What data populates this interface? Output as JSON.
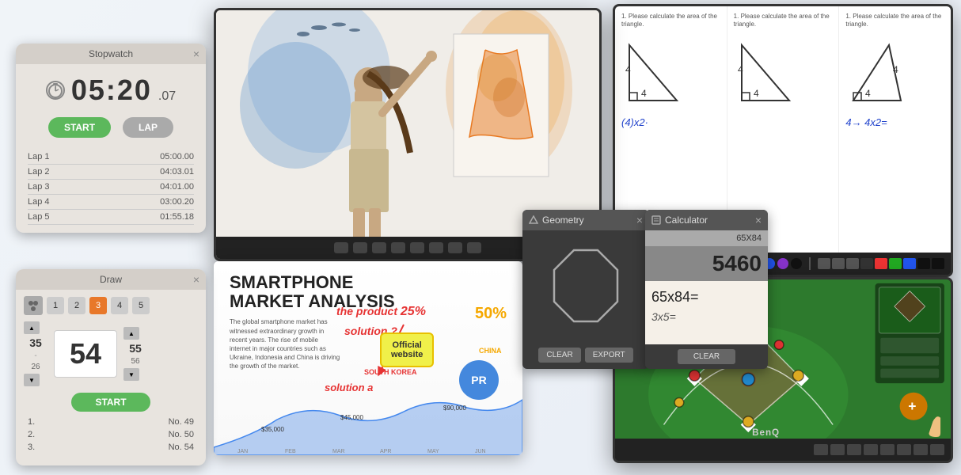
{
  "stopwatch": {
    "title": "Stopwatch",
    "time_main": "05:20",
    "time_ms": ".07",
    "btn_start": "START",
    "btn_lap": "LAP",
    "laps": [
      {
        "label": "Lap 1",
        "time": "05:00.00"
      },
      {
        "label": "Lap 2",
        "time": "04:03.01"
      },
      {
        "label": "Lap 3",
        "time": "04:01.00"
      },
      {
        "label": "Lap 4",
        "time": "03:00.20"
      },
      {
        "label": "Lap 5",
        "time": "01:55.18"
      }
    ]
  },
  "draw": {
    "title": "Draw",
    "numbers": [
      "1",
      "2",
      "3",
      "4",
      "5"
    ],
    "active_number": "3",
    "score": "54",
    "score_left": "35",
    "score_right": "55",
    "btn_start": "START",
    "results": [
      {
        "rank": "1.",
        "value": "No. 49"
      },
      {
        "rank": "2.",
        "value": "No. 50"
      },
      {
        "rank": "3.",
        "value": "No. 54"
      }
    ]
  },
  "geometry": {
    "title": "Geometry",
    "btn_clear": "CLEAR",
    "btn_export": "EXPORT"
  },
  "calculator": {
    "title": "Calculator",
    "input": "65X84",
    "result": "5460",
    "equation": "65x84=",
    "sub_equation": "3x5=",
    "btn_clear": "CLEAR"
  },
  "presentation": {
    "title": "SMARTPHONE\nMARKET ANALYSIS",
    "body_text": "The global smartphone market has witnessed extraordinary growth in recent years.",
    "annotation": "the product",
    "annotation2": "solution ?",
    "percent_25": "25%",
    "percent_50": "50%",
    "official_website": "Official\nwebsite",
    "south_korea": "SOUTH KOREA",
    "china": "CHINA",
    "circle_pr": "PR",
    "solution_a": "solution a"
  },
  "whiteboard": {
    "question": "1. Please calculate the area of the triangle.",
    "handwriting1": "(4)x2·",
    "handwriting2": "4→ 4x2=",
    "color_palette": [
      "#ee3333",
      "#22aa22",
      "#2255ee",
      "#8833cc",
      "#000000"
    ]
  },
  "sports": {
    "field_color": "#2d7a2d",
    "player_colors": [
      "#cc3333",
      "#ddaa22",
      "#ddaa22",
      "#cc3333",
      "#2288cc"
    ],
    "logo": "BenQ"
  },
  "monitor_center": {
    "toolbar_items": 8
  }
}
